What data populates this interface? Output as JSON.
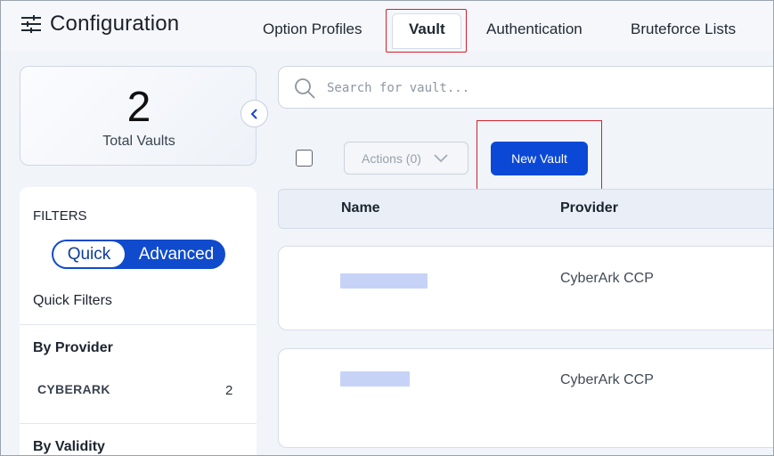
{
  "header": {
    "title": "Configuration",
    "tabs": [
      {
        "label": "Option Profiles",
        "active": false
      },
      {
        "label": "Vault",
        "active": true
      },
      {
        "label": "Authentication",
        "active": false
      },
      {
        "label": "Bruteforce Lists",
        "active": false
      }
    ]
  },
  "summary": {
    "count": "2",
    "label": "Total Vaults"
  },
  "filters": {
    "title": "FILTERS",
    "toggle": {
      "quick": "Quick",
      "advanced": "Advanced",
      "selected": "Quick"
    },
    "quick_filters_label": "Quick Filters",
    "by_provider": {
      "label": "By Provider",
      "items": [
        {
          "name": "CYBERARK",
          "count": "2"
        }
      ]
    },
    "by_validity": {
      "label": "By Validity"
    }
  },
  "search": {
    "placeholder": "Search for vault...",
    "value": ""
  },
  "toolbar": {
    "actions_label": "Actions (0)",
    "new_vault_label": "New Vault"
  },
  "table": {
    "columns": [
      "Name",
      "Provider"
    ],
    "rows": [
      {
        "name": "",
        "provider": "CyberArk CCP"
      },
      {
        "name": "",
        "provider": "CyberArk CCP"
      }
    ]
  },
  "colors": {
    "accent": "#0b48d6",
    "highlight": "#d0222d",
    "background": "#f1f4f9"
  },
  "icons": {
    "menu": "sliders-icon",
    "collapse": "chevron-left-icon",
    "search": "search-icon",
    "dropdown": "chevron-down-icon"
  }
}
